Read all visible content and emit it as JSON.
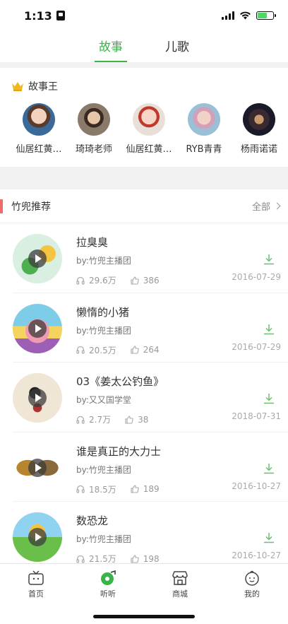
{
  "status": {
    "time": "1:13"
  },
  "tabs": [
    {
      "label": "故事",
      "active": true
    },
    {
      "label": "儿歌",
      "active": false
    }
  ],
  "kings": {
    "title": "故事王",
    "items": [
      {
        "name": "仙居红黄…"
      },
      {
        "name": "琦琦老师"
      },
      {
        "name": "仙居红黄…"
      },
      {
        "name": "RYB青青"
      },
      {
        "name": "杨雨诺诺"
      }
    ]
  },
  "recommend": {
    "title": "竹兜推荐",
    "all_label": "全部",
    "items": [
      {
        "title": "拉臭臭",
        "by": "by:竹兜主播团",
        "plays": "29.6万",
        "likes": "386",
        "date": "2016-07-29"
      },
      {
        "title": "懒惰的小猪",
        "by": "by:竹兜主播团",
        "plays": "20.5万",
        "likes": "264",
        "date": "2016-07-29"
      },
      {
        "title": "03《姜太公钓鱼》",
        "by": "by:又又国学堂",
        "plays": "2.7万",
        "likes": "38",
        "date": "2018-07-31"
      },
      {
        "title": "谁是真正的大力士",
        "by": "by:竹兜主播团",
        "plays": "18.5万",
        "likes": "189",
        "date": "2016-10-27"
      },
      {
        "title": "数恐龙",
        "by": "by:竹兜主播团",
        "plays": "21.5万",
        "likes": "198",
        "date": "2016-10-27"
      }
    ]
  },
  "nav": [
    {
      "label": "首页",
      "icon": "tv-icon"
    },
    {
      "label": "听听",
      "icon": "music-disc-icon",
      "active": true
    },
    {
      "label": "商城",
      "icon": "shop-icon"
    },
    {
      "label": "我的",
      "icon": "baby-face-icon"
    }
  ],
  "colors": {
    "accent": "#3bb34a",
    "section_bar": "#f06c6c"
  }
}
